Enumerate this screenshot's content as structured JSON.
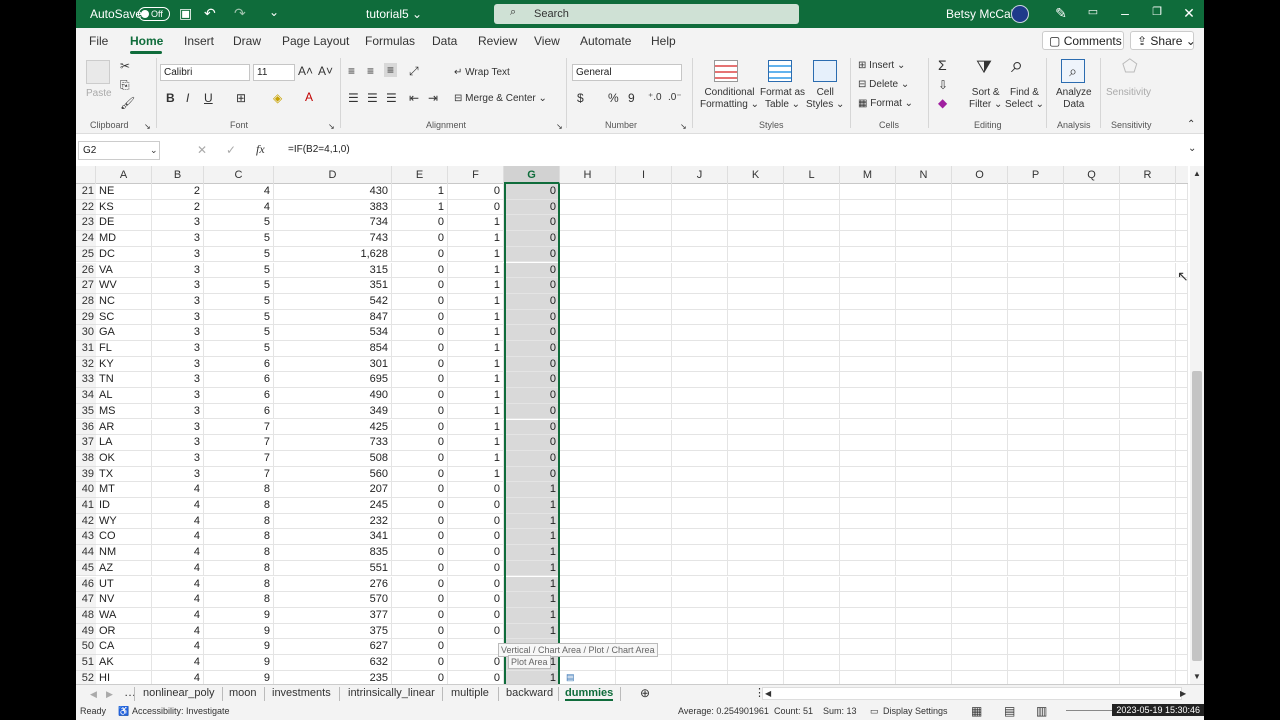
{
  "titlebar": {
    "autosave": "AutoSave",
    "toggle": "Off",
    "filename": "tutorial5 ⌄",
    "search_placeholder": "Search",
    "user": "Betsy McCall"
  },
  "tabs": [
    "File",
    "Home",
    "Insert",
    "Draw",
    "Page Layout",
    "Formulas",
    "Data",
    "Review",
    "View",
    "Automate",
    "Help"
  ],
  "comments_label": "Comments",
  "share_label": "Share ⌄",
  "ribbon": {
    "clipboard": {
      "paste": "Paste",
      "group": "Clipboard"
    },
    "font": {
      "name": "Calibri",
      "size": "11",
      "group": "Font"
    },
    "alignment": {
      "wrap": "Wrap Text",
      "merge": "Merge & Center ⌄",
      "group": "Alignment"
    },
    "number": {
      "format": "General",
      "group": "Number"
    },
    "styles": {
      "cond1": "Conditional",
      "cond2": "Formatting ⌄",
      "fmt1": "Format as",
      "fmt2": "Table ⌄",
      "cell1": "Cell",
      "cell2": "Styles ⌄",
      "group": "Styles"
    },
    "cells": {
      "insert": "Insert ⌄",
      "delete": "Delete ⌄",
      "format": "Format ⌄",
      "group": "Cells"
    },
    "editing": {
      "sort1": "Sort &",
      "sort2": "Filter ⌄",
      "find1": "Find &",
      "find2": "Select ⌄",
      "group": "Editing"
    },
    "analysis": {
      "a1": "Analyze",
      "a2": "Data",
      "group": "Analysis"
    },
    "sensitivity": {
      "label": "Sensitivity",
      "group": "Sensitivity"
    }
  },
  "namebox": "G2",
  "formula": "=IF(B2=4,1,0)",
  "columns": [
    "A",
    "B",
    "C",
    "D",
    "E",
    "F",
    "G",
    "H",
    "I",
    "J",
    "K",
    "L",
    "M",
    "N",
    "O",
    "P",
    "Q",
    "R"
  ],
  "rows": [
    [
      "21",
      "NE",
      "2",
      "4",
      "430",
      "1",
      "0",
      "0"
    ],
    [
      "22",
      "KS",
      "2",
      "4",
      "383",
      "1",
      "0",
      "0"
    ],
    [
      "23",
      "DE",
      "3",
      "5",
      "734",
      "0",
      "1",
      "0"
    ],
    [
      "24",
      "MD",
      "3",
      "5",
      "743",
      "0",
      "1",
      "0"
    ],
    [
      "25",
      "DC",
      "3",
      "5",
      "1,628",
      "0",
      "1",
      "0"
    ],
    [
      "26",
      "VA",
      "3",
      "5",
      "315",
      "0",
      "1",
      "0"
    ],
    [
      "27",
      "WV",
      "3",
      "5",
      "351",
      "0",
      "1",
      "0"
    ],
    [
      "28",
      "NC",
      "3",
      "5",
      "542",
      "0",
      "1",
      "0"
    ],
    [
      "29",
      "SC",
      "3",
      "5",
      "847",
      "0",
      "1",
      "0"
    ],
    [
      "30",
      "GA",
      "3",
      "5",
      "534",
      "0",
      "1",
      "0"
    ],
    [
      "31",
      "FL",
      "3",
      "5",
      "854",
      "0",
      "1",
      "0"
    ],
    [
      "32",
      "KY",
      "3",
      "6",
      "301",
      "0",
      "1",
      "0"
    ],
    [
      "33",
      "TN",
      "3",
      "6",
      "695",
      "0",
      "1",
      "0"
    ],
    [
      "34",
      "AL",
      "3",
      "6",
      "490",
      "0",
      "1",
      "0"
    ],
    [
      "35",
      "MS",
      "3",
      "6",
      "349",
      "0",
      "1",
      "0"
    ],
    [
      "36",
      "AR",
      "3",
      "7",
      "425",
      "0",
      "1",
      "0"
    ],
    [
      "37",
      "LA",
      "3",
      "7",
      "733",
      "0",
      "1",
      "0"
    ],
    [
      "38",
      "OK",
      "3",
      "7",
      "508",
      "0",
      "1",
      "0"
    ],
    [
      "39",
      "TX",
      "3",
      "7",
      "560",
      "0",
      "1",
      "0"
    ],
    [
      "40",
      "MT",
      "4",
      "8",
      "207",
      "0",
      "0",
      "1"
    ],
    [
      "41",
      "ID",
      "4",
      "8",
      "245",
      "0",
      "0",
      "1"
    ],
    [
      "42",
      "WY",
      "4",
      "8",
      "232",
      "0",
      "0",
      "1"
    ],
    [
      "43",
      "CO",
      "4",
      "8",
      "341",
      "0",
      "0",
      "1"
    ],
    [
      "44",
      "NM",
      "4",
      "8",
      "835",
      "0",
      "0",
      "1"
    ],
    [
      "45",
      "AZ",
      "4",
      "8",
      "551",
      "0",
      "0",
      "1"
    ],
    [
      "46",
      "UT",
      "4",
      "8",
      "276",
      "0",
      "0",
      "1"
    ],
    [
      "47",
      "NV",
      "4",
      "8",
      "570",
      "0",
      "0",
      "1"
    ],
    [
      "48",
      "WA",
      "4",
      "9",
      "377",
      "0",
      "0",
      "1"
    ],
    [
      "49",
      "OR",
      "4",
      "9",
      "375",
      "0",
      "0",
      "1"
    ],
    [
      "50",
      "CA",
      "4",
      "9",
      "627",
      "0",
      "",
      ""
    ],
    [
      "51",
      "AK",
      "4",
      "9",
      "632",
      "0",
      "0",
      "1"
    ],
    [
      "52",
      "HI",
      "4",
      "9",
      "235",
      "0",
      "0",
      "1"
    ]
  ],
  "tooltip": {
    "line1": "Vertical / Chart Area / Plot / Chart Area",
    "line2": "Plot Area"
  },
  "sheets": [
    "nonlinear_poly",
    "moon",
    "investments",
    "intrinsically_linear",
    "multiple",
    "backward",
    "dummies"
  ],
  "status": {
    "ready": "Ready",
    "accessibility": "Accessibility: Investigate",
    "average": "Average: 0.254901961",
    "count": "Count: 51",
    "sum": "Sum: 13",
    "display": "Display Settings",
    "clock": "2023-05-19 15:30:46"
  }
}
